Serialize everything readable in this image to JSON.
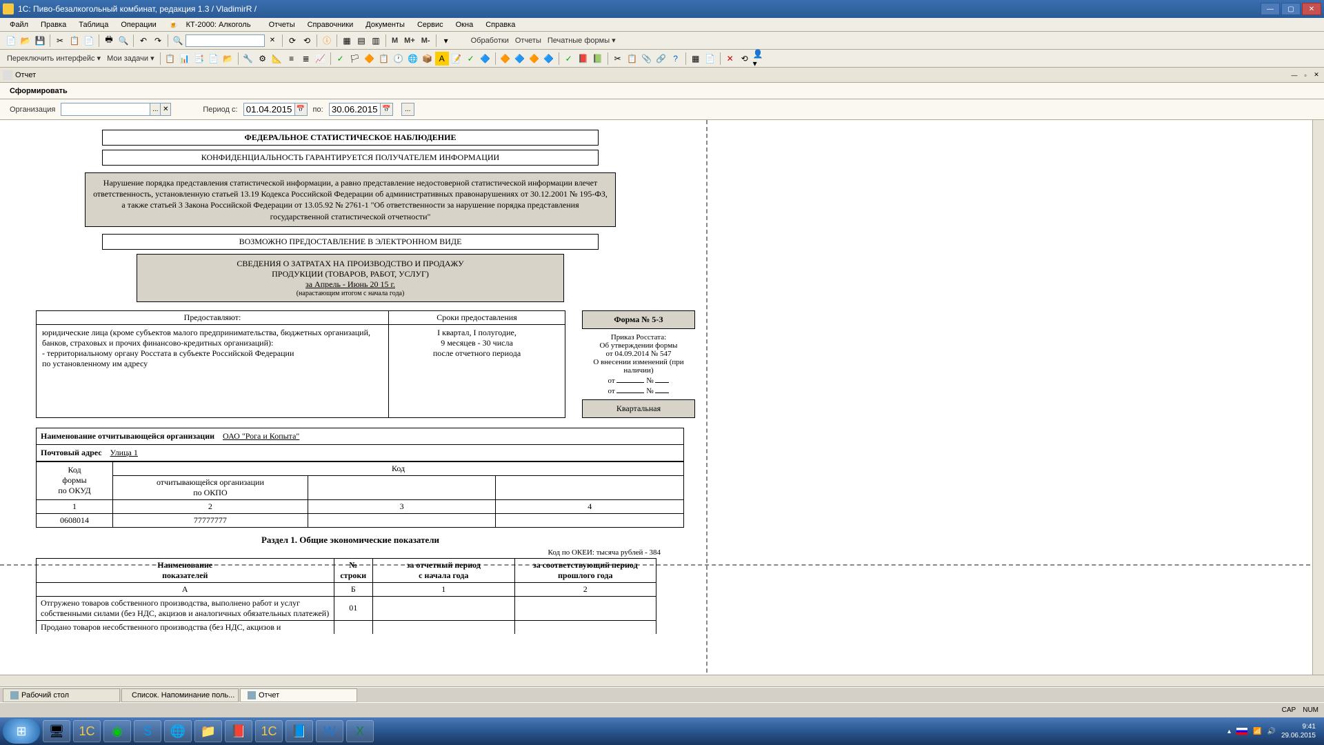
{
  "titlebar": {
    "text": "1С: Пиво-безалкогольный комбинат, редакция 1.3 / VladimirR /"
  },
  "menu": [
    "Файл",
    "Правка",
    "Таблица",
    "Операции",
    "КТ-2000: Алкоголь",
    "Отчеты",
    "Справочники",
    "Документы",
    "Сервис",
    "Окна",
    "Справка"
  ],
  "toolbar": {
    "switch": "Переключить интерфейс ▾",
    "tasks": "Мои задачи ▾",
    "proc": "Обработки",
    "rep": "Отчеты",
    "print": "Печатные формы ▾",
    "m1": "M",
    "m2": "M+",
    "m3": "M-"
  },
  "subtab": {
    "title": "Отчет"
  },
  "actbar": {
    "form": "Сформировать"
  },
  "params": {
    "org_label": "Организация",
    "org_value": "",
    "period_from_label": "Период с:",
    "period_from": "01.04.2015",
    "period_to_label": "по:",
    "period_to": "30.06.2015"
  },
  "doc": {
    "h1": "ФЕДЕРАЛЬНОЕ СТАТИСТИЧЕСКОЕ НАБЛЮДЕНИЕ",
    "h2": "КОНФИДЕНЦИАЛЬНОСТЬ ГАРАНТИРУЕТСЯ ПОЛУЧАТЕЛЕМ ИНФОРМАЦИИ",
    "warn": "Нарушение порядка представления статистической информации, а равно представление недостоверной статистической информации влечет ответственность, установленную статьей 13.19 Кодекса Российской Федерации об административных правонарушениях от 30.12.2001 № 195-ФЗ, а также статьей 3 Закона Российской Федерации от 13.05.92 № 2761-1 \"Об ответственности за нарушение порядка представления государственной статистической отчетности\"",
    "h3": "ВОЗМОЖНО ПРЕДОСТАВЛЕНИЕ В ЭЛЕКТРОННОМ ВИДЕ",
    "title1": "СВЕДЕНИЯ О ЗАТРАТАХ НА ПРОИЗВОДСТВО И ПРОДАЖУ",
    "title2": "ПРОДУКЦИИ (ТОВАРОВ, РАБОТ, УСЛУГ)",
    "period": "за Апрель  -       Июнь       20 15   г.",
    "period_note": "(нарастающим итогом с начала года)",
    "tbl1": {
      "h1": "Предоставляют:",
      "h2": "Сроки предоставления",
      "b1": "юридические лица (кроме субъектов малого предпринимательства, бюджетных организаций, банков, страховых и прочих финансово-кредитных организаций):\n  - территориальному органу Росстата в субъекте Российской Федерации\n    по установленному им адресу",
      "b2": "I квартал, I полугодие,\n9 месяцев - 30 числа\nпосле отчетного периода"
    },
    "side": {
      "form": "Форма № 5-З",
      "l1": "Приказ Росстата:",
      "l2": "Об утверждении формы",
      "l3": "от 04.09.2014 № 547",
      "l4": "О внесении изменений (при наличии)",
      "l5": "от ____________ № ____",
      "l6": "от ____________ № ____",
      "quart": "Квартальная"
    },
    "org": {
      "name_lbl": "Наименование отчитывающейся организации",
      "name_val": "ОАО \"Рога и Копыта\"",
      "addr_lbl": "Почтовый адрес",
      "addr_val": "Улица 1"
    },
    "codes": {
      "h_code": "Код",
      "h_okud": "формы\nпо ОКУД",
      "h_okpo": "отчитывающейся организации\nпо ОКПО",
      "r_okud": "Код",
      "v1": "1",
      "v2": "2",
      "v3": "3",
      "v4": "4",
      "okud": "0608014",
      "okpo": "77777777"
    },
    "sec1": "Раздел 1. Общие экономические показатели",
    "okei": "Код по ОКЕИ: тысяча рублей - 384",
    "dtbl": {
      "h1": "Наименование\nпоказателей",
      "h2": "№\nстроки",
      "h3": "за отчетный период\nс начала года",
      "h4": "за соответствующий период\nпрошлого года",
      "a": "А",
      "b": "Б",
      "c1": "1",
      "c2": "2",
      "r1": "Отгружено товаров собственного производства, выполнено работ и услуг собственными силами (без НДС, акцизов и аналогичных обязательных платежей)",
      "r1n": "01",
      "r2": "Продано товаров несобственного производства (без НДС, акцизов и"
    }
  },
  "wintabs": {
    "t1": "Рабочий стол",
    "t2": "Список. Напоминание поль...",
    "t3": "Отчет"
  },
  "status": {
    "cap": "CAP",
    "num": "NUM"
  },
  "tray": {
    "time": "9:41",
    "date": "29.06.2015"
  }
}
